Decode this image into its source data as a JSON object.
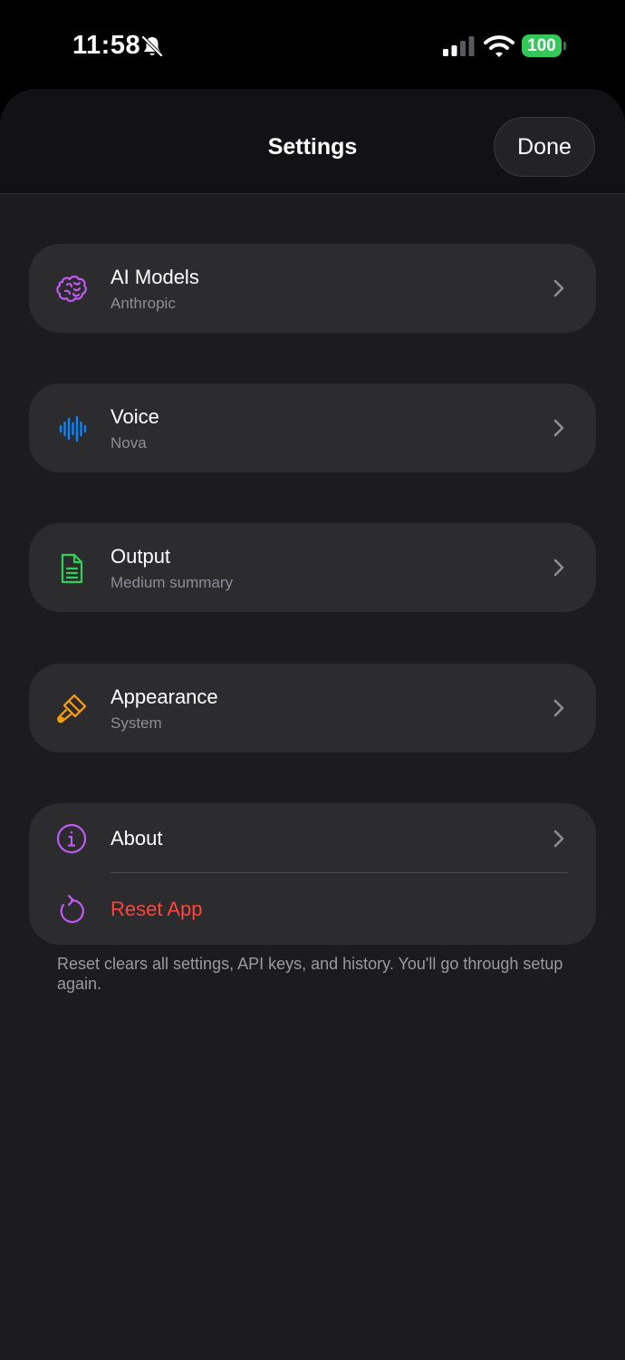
{
  "status_bar": {
    "time": "11:58",
    "battery": "100",
    "icons": [
      "bell-slash-icon",
      "cellular-signal-icon",
      "wifi-icon",
      "battery-icon"
    ]
  },
  "nav": {
    "title": "Settings",
    "done_label": "Done"
  },
  "items": [
    {
      "title": "AI Models",
      "subtitle": "Anthropic",
      "icon": "brain-icon",
      "icon_color": "#bf5af2"
    },
    {
      "title": "Voice",
      "subtitle": "Nova",
      "icon": "waveform-icon",
      "icon_color": "#0a84ff"
    },
    {
      "title": "Output",
      "subtitle": "Medium summary",
      "icon": "document-icon",
      "icon_color": "#30d158"
    },
    {
      "title": "Appearance",
      "subtitle": "System",
      "icon": "paintbrush-icon",
      "icon_color": "#ff9f0a"
    }
  ],
  "about": {
    "title": "About",
    "icon": "info-circle-icon",
    "icon_color": "#bf5af2"
  },
  "reset": {
    "title": "Reset App",
    "icon": "reset-arrow-icon",
    "icon_color": "#bf5af2",
    "title_color": "#ff453a"
  },
  "footnote": "Reset clears all settings, API keys, and history. You'll go through setup again."
}
